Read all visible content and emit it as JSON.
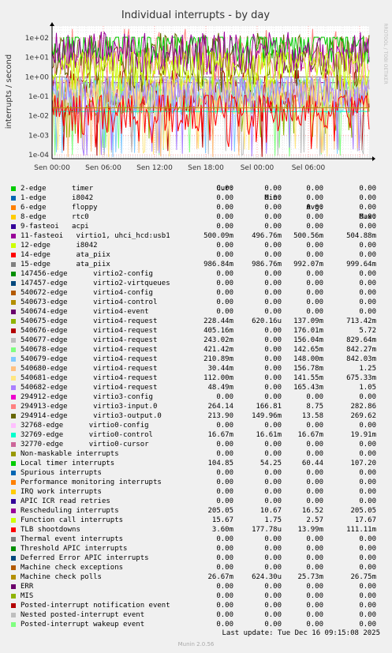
{
  "chart_data": {
    "type": "line",
    "title": "Individual interrupts - by day",
    "ylabel": "interrupts / second",
    "side_label": "RRDTOOL / TOBI OETIKER",
    "scale": "log",
    "ylim": [
      6.32e-05,
      400
    ],
    "y_ticks": [
      "1e-04",
      "1e-03",
      "1e-02",
      "1e-01",
      "1e+00",
      "1e+01",
      "1e+02"
    ],
    "x_ticks": [
      "Sen 00:00",
      "Sen 06:00",
      "Sen 12:00",
      "Sen 18:00",
      "Sel 00:00",
      "Sel 06:00"
    ],
    "grid": true,
    "legend_placement": "bottom",
    "columns": [
      "Cur:",
      "Min:",
      "Avg:",
      "Max:"
    ],
    "series": [
      {
        "name": "2-edge      timer",
        "color": "#00cc00",
        "cur": "0.00",
        "min": "0.00",
        "avg": "0.00",
        "max": "0.00"
      },
      {
        "name": "1-edge      i8042",
        "color": "#0066b3",
        "cur": "0.00",
        "min": "0.00",
        "avg": "0.00",
        "max": "0.00"
      },
      {
        "name": "6-edge      floppy",
        "color": "#ff8000",
        "cur": "0.00",
        "min": "0.00",
        "avg": "0.00",
        "max": "0.00"
      },
      {
        "name": "8-edge      rtc0",
        "color": "#ffcc00",
        "cur": "0.00",
        "min": "0.00",
        "avg": "0.00",
        "max": "0.00"
      },
      {
        "name": "9-fasteoi   acpi",
        "color": "#330099",
        "cur": "0.00",
        "min": "0.00",
        "avg": "0.00",
        "max": "0.00"
      },
      {
        "name": "11-fasteoi   virtio1, uhci_hcd:usb1",
        "color": "#990099",
        "cur": "500.09m",
        "min": "496.76m",
        "avg": "500.56m",
        "max": "504.88m"
      },
      {
        "name": "12-edge      i8042",
        "color": "#ccff00",
        "cur": "0.00",
        "min": "0.00",
        "avg": "0.00",
        "max": "0.00"
      },
      {
        "name": "14-edge      ata_piix",
        "color": "#ff0000",
        "cur": "0.00",
        "min": "0.00",
        "avg": "0.00",
        "max": "0.00"
      },
      {
        "name": "15-edge      ata_piix",
        "color": "#808080",
        "cur": "986.84m",
        "min": "986.76m",
        "avg": "992.07m",
        "max": "999.64m"
      },
      {
        "name": "147456-edge      virtio2-config",
        "color": "#008f00",
        "cur": "0.00",
        "min": "0.00",
        "avg": "0.00",
        "max": "0.00"
      },
      {
        "name": "147457-edge      virtio2-virtqueues",
        "color": "#00487d",
        "cur": "0.00",
        "min": "0.00",
        "avg": "0.00",
        "max": "0.00"
      },
      {
        "name": "540672-edge      virtio4-config",
        "color": "#b35a00",
        "cur": "0.00",
        "min": "0.00",
        "avg": "0.00",
        "max": "0.00"
      },
      {
        "name": "540673-edge      virtio4-control",
        "color": "#b38f00",
        "cur": "0.00",
        "min": "0.00",
        "avg": "0.00",
        "max": "0.00"
      },
      {
        "name": "540674-edge      virtio4-event",
        "color": "#6b006b",
        "cur": "0.00",
        "min": "0.00",
        "avg": "0.00",
        "max": "0.00"
      },
      {
        "name": "540675-edge      virtio4-request",
        "color": "#8fb300",
        "cur": "228.44m",
        "min": "620.16u",
        "avg": "137.09m",
        "max": "713.42m"
      },
      {
        "name": "540676-edge      virtio4-request",
        "color": "#b30000",
        "cur": "405.16m",
        "min": "0.00",
        "avg": "176.01m",
        "max": "5.72"
      },
      {
        "name": "540677-edge      virtio4-request",
        "color": "#bebebe",
        "cur": "243.02m",
        "min": "0.00",
        "avg": "156.04m",
        "max": "829.64m"
      },
      {
        "name": "540678-edge      virtio4-request",
        "color": "#80ff80",
        "cur": "421.42m",
        "min": "0.00",
        "avg": "142.65m",
        "max": "842.27m"
      },
      {
        "name": "540679-edge      virtio4-request",
        "color": "#80c9ff",
        "cur": "210.89m",
        "min": "0.00",
        "avg": "148.00m",
        "max": "842.03m"
      },
      {
        "name": "540680-edge      virtio4-request",
        "color": "#ffc080",
        "cur": "30.44m",
        "min": "0.00",
        "avg": "156.78m",
        "max": "1.25"
      },
      {
        "name": "540681-edge      virtio4-request",
        "color": "#ffe680",
        "cur": "112.00m",
        "min": "0.00",
        "avg": "141.55m",
        "max": "675.33m"
      },
      {
        "name": "540682-edge      virtio4-request",
        "color": "#aa80ff",
        "cur": "48.49m",
        "min": "0.00",
        "avg": "165.43m",
        "max": "1.05"
      },
      {
        "name": "294912-edge      virtio3-config",
        "color": "#ee00cc",
        "cur": "0.00",
        "min": "0.00",
        "avg": "0.00",
        "max": "0.00"
      },
      {
        "name": "294913-edge      virtio3-input.0",
        "color": "#ff8080",
        "cur": "264.14",
        "min": "166.81",
        "avg": "8.75",
        "max": "282.86"
      },
      {
        "name": "294914-edge      virtio3-output.0",
        "color": "#666600",
        "cur": "213.90",
        "min": "149.96m",
        "avg": "13.58",
        "max": "269.62"
      },
      {
        "name": "32768-edge      virtio0-config",
        "color": "#ffbfff",
        "cur": "0.00",
        "min": "0.00",
        "avg": "0.00",
        "max": "0.00"
      },
      {
        "name": "32769-edge      virtio0-control",
        "color": "#00ffcc",
        "cur": "16.67m",
        "min": "16.61m",
        "avg": "16.67m",
        "max": "19.91m"
      },
      {
        "name": "32770-edge      virtio0-cursor",
        "color": "#cc6699",
        "cur": "0.00",
        "min": "0.00",
        "avg": "0.00",
        "max": "0.00"
      },
      {
        "name": "Non-maskable interrupts",
        "color": "#999900",
        "cur": "0.00",
        "min": "0.00",
        "avg": "0.00",
        "max": "0.00"
      },
      {
        "name": "Local timer interrupts",
        "color": "#00cc00",
        "cur": "104.85",
        "min": "54.25",
        "avg": "60.44",
        "max": "107.20"
      },
      {
        "name": "Spurious interrupts",
        "color": "#0066b3",
        "cur": "0.00",
        "min": "0.00",
        "avg": "0.00",
        "max": "0.00"
      },
      {
        "name": "Performance monitoring interrupts",
        "color": "#ff8000",
        "cur": "0.00",
        "min": "0.00",
        "avg": "0.00",
        "max": "0.00"
      },
      {
        "name": "IRQ work interrupts",
        "color": "#ffcc00",
        "cur": "0.00",
        "min": "0.00",
        "avg": "0.00",
        "max": "0.00"
      },
      {
        "name": "APIC ICR read retries",
        "color": "#330099",
        "cur": "0.00",
        "min": "0.00",
        "avg": "0.00",
        "max": "0.00"
      },
      {
        "name": "Rescheduling interrupts",
        "color": "#990099",
        "cur": "205.05",
        "min": "10.67",
        "avg": "16.52",
        "max": "205.05"
      },
      {
        "name": "Function call interrupts",
        "color": "#ccff00",
        "cur": "15.67",
        "min": "1.75",
        "avg": "2.57",
        "max": "17.67"
      },
      {
        "name": "TLB shootdowns",
        "color": "#ff0000",
        "cur": "3.60m",
        "min": "177.78u",
        "avg": "13.99m",
        "max": "111.11m"
      },
      {
        "name": "Thermal event interrupts",
        "color": "#808080",
        "cur": "0.00",
        "min": "0.00",
        "avg": "0.00",
        "max": "0.00"
      },
      {
        "name": "Threshold APIC interrupts",
        "color": "#008f00",
        "cur": "0.00",
        "min": "0.00",
        "avg": "0.00",
        "max": "0.00"
      },
      {
        "name": "Deferred Error APIC interrupts",
        "color": "#00487d",
        "cur": "0.00",
        "min": "0.00",
        "avg": "0.00",
        "max": "0.00"
      },
      {
        "name": "Machine check exceptions",
        "color": "#b35a00",
        "cur": "0.00",
        "min": "0.00",
        "avg": "0.00",
        "max": "0.00"
      },
      {
        "name": "Machine check polls",
        "color": "#b38f00",
        "cur": "26.67m",
        "min": "624.30u",
        "avg": "25.73m",
        "max": "26.75m"
      },
      {
        "name": "ERR",
        "color": "#6b006b",
        "cur": "0.00",
        "min": "0.00",
        "avg": "0.00",
        "max": "0.00"
      },
      {
        "name": "MIS",
        "color": "#8fb300",
        "cur": "0.00",
        "min": "0.00",
        "avg": "0.00",
        "max": "0.00"
      },
      {
        "name": "Posted-interrupt notification event",
        "color": "#b30000",
        "cur": "0.00",
        "min": "0.00",
        "avg": "0.00",
        "max": "0.00"
      },
      {
        "name": "Nested posted-interrupt event",
        "color": "#bebebe",
        "cur": "0.00",
        "min": "0.00",
        "avg": "0.00",
        "max": "0.00"
      },
      {
        "name": "Posted-interrupt wakeup event",
        "color": "#80ff80",
        "cur": "0.00",
        "min": "0.00",
        "avg": "0.00",
        "max": "0.00"
      }
    ]
  },
  "footer": {
    "last_update": "Last update: Tue Dec 16 09:15:08 2025",
    "munin": "Munin 2.0.56"
  }
}
